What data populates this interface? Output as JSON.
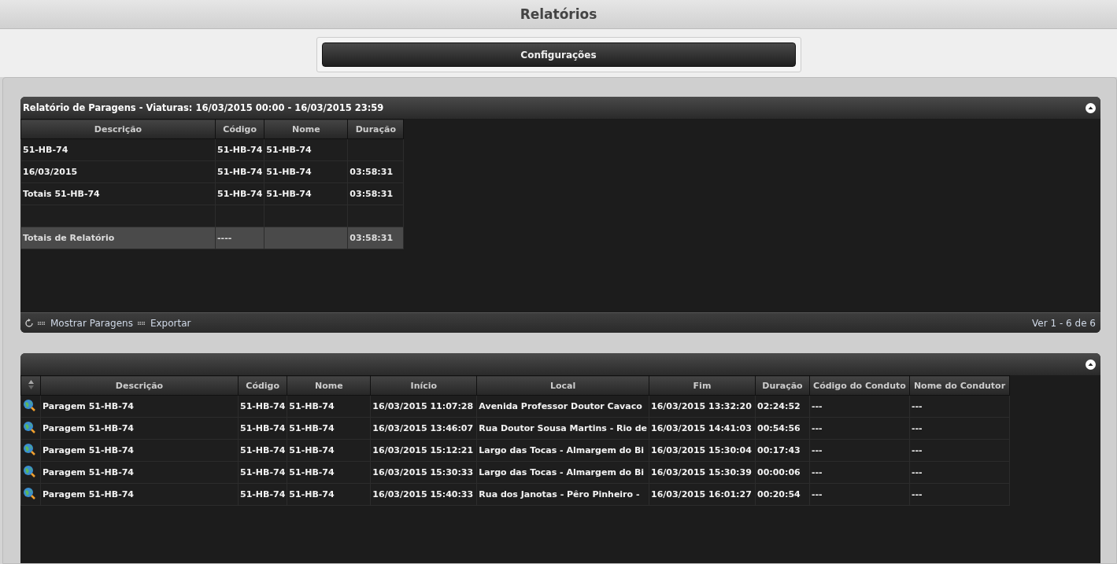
{
  "page_title": "Relatórios",
  "config_button": "Configurações",
  "summary": {
    "title": "Relatório de Paragens - Viaturas: 16/03/2015 00:00 - 16/03/2015 23:59",
    "columns": [
      "Descrição",
      "Código",
      "Nome",
      "Duração"
    ],
    "rows": [
      {
        "kind": "normal",
        "cells": [
          "51-HB-74",
          "51-HB-74",
          "51-HB-74",
          null
        ]
      },
      {
        "kind": "normal",
        "cells": [
          "16/03/2015",
          "51-HB-74",
          "51-HB-74",
          "03:58:31"
        ]
      },
      {
        "kind": "normal",
        "cells": [
          "Totais 51-HB-74",
          "51-HB-74",
          "51-HB-74",
          "03:58:31"
        ]
      },
      {
        "kind": "blank",
        "cells": [
          null,
          null,
          null,
          null
        ]
      },
      {
        "kind": "total",
        "cells": [
          "Totais de Relatório",
          "----",
          null,
          "03:58:31"
        ]
      }
    ],
    "actions": [
      "Mostrar Paragens",
      "Exportar"
    ],
    "pager": "Ver 1 - 6 de 6"
  },
  "stops": {
    "columns": [
      "Descrição",
      "Código",
      "Nome",
      "Início",
      "Local",
      "Fim",
      "Duração",
      "Código do Conduto",
      "Nome do Condutor"
    ],
    "rows": [
      {
        "cells": [
          "Paragem 51-HB-74",
          "51-HB-74",
          "51-HB-74",
          "16/03/2015 11:07:28",
          "Avenida Professor Doutor Cavaco",
          "16/03/2015 13:32:20",
          "02:24:52",
          "---",
          "---"
        ]
      },
      {
        "cells": [
          "Paragem 51-HB-74",
          "51-HB-74",
          "51-HB-74",
          "16/03/2015 13:46:07",
          "Rua Doutor Sousa Martins - Rio de",
          "16/03/2015 14:41:03",
          "00:54:56",
          "---",
          "---"
        ]
      },
      {
        "cells": [
          "Paragem 51-HB-74",
          "51-HB-74",
          "51-HB-74",
          "16/03/2015 15:12:21",
          "Largo das Tocas - Almargem do Bi",
          "16/03/2015 15:30:04",
          "00:17:43",
          "---",
          "---"
        ]
      },
      {
        "cells": [
          "Paragem 51-HB-74",
          "51-HB-74",
          "51-HB-74",
          "16/03/2015 15:30:33",
          "Largo das Tocas - Almargem do Bi",
          "16/03/2015 15:30:39",
          "00:00:06",
          "---",
          "---"
        ]
      },
      {
        "cells": [
          "Paragem 51-HB-74",
          "51-HB-74",
          "51-HB-74",
          "16/03/2015 15:40:33",
          "Rua dos Janotas - Pêro Pinheiro -",
          "16/03/2015 16:01:27",
          "00:20:54",
          "---",
          "---"
        ]
      }
    ]
  }
}
